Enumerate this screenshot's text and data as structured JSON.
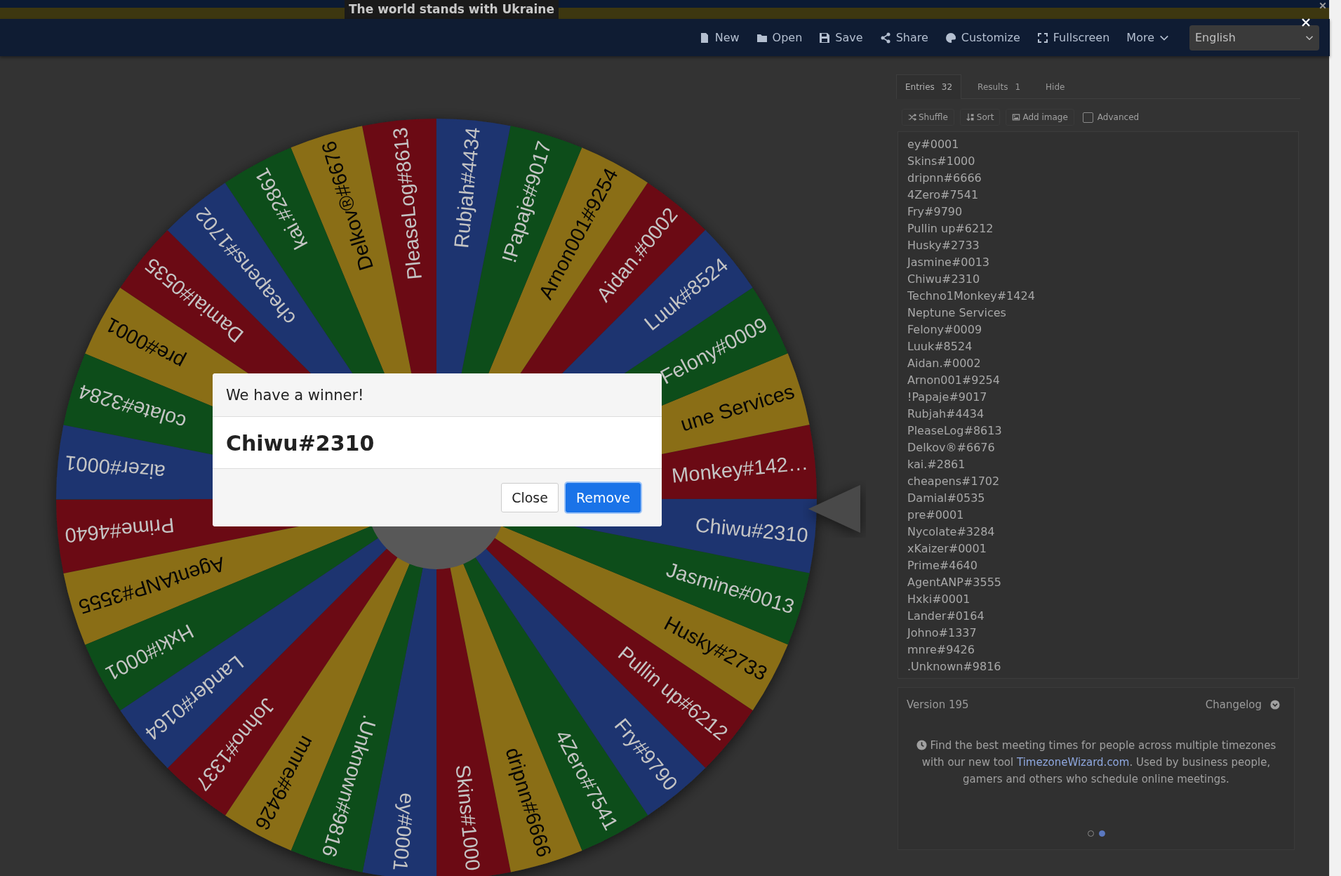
{
  "banner": {
    "text": "The world stands with Ukraine"
  },
  "toolbar": [
    {
      "label": "New",
      "kind": "new"
    },
    {
      "label": "Open",
      "kind": "open"
    },
    {
      "label": "Save",
      "kind": "save"
    },
    {
      "label": "Share",
      "kind": "share"
    },
    {
      "label": "Customize",
      "kind": "customize"
    },
    {
      "label": "Fullscreen",
      "kind": "fullscreen"
    },
    {
      "label": "More",
      "kind": "more"
    }
  ],
  "language": {
    "value": "English"
  },
  "wheel": {
    "segments": [
      {
        "label": "ey#0001"
      },
      {
        "label": "Skins#1000"
      },
      {
        "label": "dripnn#6666"
      },
      {
        "label": "4Zero#7541"
      },
      {
        "label": "Fry#9790"
      },
      {
        "label": "Pullin up#6212"
      },
      {
        "label": "Husky#2733"
      },
      {
        "label": "Jasmine#0013"
      },
      {
        "label": "Chiwu#2310"
      },
      {
        "label": "Monkey#142…"
      },
      {
        "label": "une Services"
      },
      {
        "label": "Felony#0009"
      },
      {
        "label": "Luuk#8524"
      },
      {
        "label": "Aidan.#0002"
      },
      {
        "label": "Arnon001#9254"
      },
      {
        "label": "!Papaje#9017"
      },
      {
        "label": "Rubjah#4434"
      },
      {
        "label": "PleaseLog#8613"
      },
      {
        "label": "Delkov®#6676"
      },
      {
        "label": "kai.#2861"
      },
      {
        "label": "cheapens#1702"
      },
      {
        "label": "Damial#0535"
      },
      {
        "label": "pre#0001"
      },
      {
        "label": "colate#3284"
      },
      {
        "label": "aizer#0001"
      },
      {
        "label": "Prime#4640"
      },
      {
        "label": "AgentANP#3555"
      },
      {
        "label": "Hxki#0001"
      },
      {
        "label": "Lander#0164"
      },
      {
        "label": "Johno#1337"
      },
      {
        "label": "mnre#9426"
      },
      {
        "label": ".Unknown#9816"
      }
    ]
  },
  "panel": {
    "tabs": [
      {
        "label": "Entries",
        "count": "32",
        "selected": true
      },
      {
        "label": "Results",
        "count": "1",
        "selected": false
      },
      {
        "label": "Hide",
        "selected": false
      }
    ],
    "actions": [
      {
        "label": "Shuffle",
        "kind": "shuffle"
      },
      {
        "label": "Sort",
        "kind": "sort"
      },
      {
        "label": "Add image",
        "kind": "image"
      }
    ],
    "advanced": {
      "label": "Advanced",
      "checked": false
    },
    "entries": [
      "ey#0001",
      "Skins#1000",
      "dripnn#6666",
      "4Zero#7541",
      "Fry#9790",
      "Pullin up#6212",
      "Husky#2733",
      "Jasmine#0013",
      "Chiwu#2310",
      "Techno1Monkey#1424",
      "Neptune Services",
      "Felony#0009",
      "Luuk#8524",
      "Aidan.#0002",
      "Arnon001#9254",
      "!Papaje#9017",
      "Rubjah#4434",
      "PleaseLog#8613",
      "Delkov®#6676",
      "kai.#2861",
      "cheapens#1702",
      "Damial#0535",
      "pre#0001",
      "Nycolate#3284",
      "xKaizer#0001",
      "Prime#4640",
      "AgentANP#3555",
      "Hxki#0001",
      "Lander#0164",
      "Johno#1337",
      "mnre#9426",
      ".Unknown#9816"
    ],
    "footer": {
      "version": "Version 195",
      "changelog": "Changelog",
      "message_before": "Find the best meeting times for people across multiple timezones with our new tool ",
      "link": "TimezoneWizard.com",
      "message_after": ". Used by business people, gamers and others who schedule online meetings.",
      "dots": [
        {
          "selected": false
        },
        {
          "selected": true
        }
      ]
    }
  },
  "dialog": {
    "title": "We have a winner!",
    "winner": "Chiwu#2310",
    "buttons": [
      {
        "label": "Close",
        "kind": "secondary"
      },
      {
        "label": "Remove",
        "kind": "primary"
      }
    ]
  }
}
